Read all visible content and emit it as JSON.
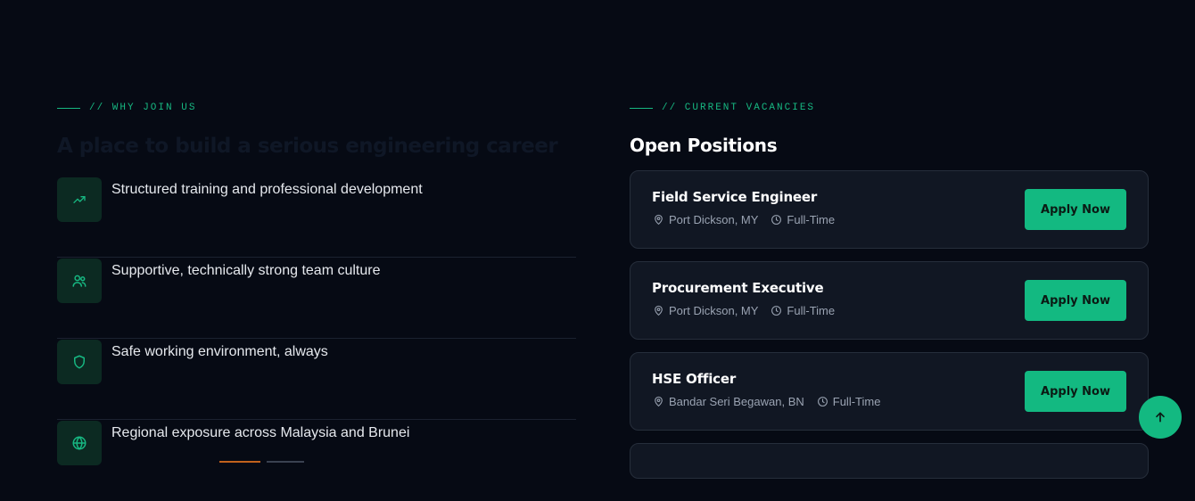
{
  "why_join": {
    "eyebrow": "// WHY JOIN US",
    "heading": "A place to build a serious engineering career",
    "benefits": [
      {
        "icon": "trending-up-icon",
        "text": "Structured training and professional development"
      },
      {
        "icon": "users-icon",
        "text": "Supportive, technically strong team culture"
      },
      {
        "icon": "shield-icon",
        "text": "Safe working environment, always"
      },
      {
        "icon": "globe-icon",
        "text": "Regional exposure across Malaysia and Brunei"
      }
    ]
  },
  "vacancies": {
    "eyebrow": "// CURRENT VACANCIES",
    "title": "Open Positions",
    "apply_label": "Apply Now",
    "jobs": [
      {
        "title": "Field Service Engineer",
        "location": "Port Dickson, MY",
        "type": "Full-Time"
      },
      {
        "title": "Procurement Executive",
        "location": "Port Dickson, MY",
        "type": "Full-Time"
      },
      {
        "title": "HSE Officer",
        "location": "Bandar Seri Begawan, BN",
        "type": "Full-Time"
      }
    ]
  },
  "colors": {
    "background": "#060a14",
    "accent": "#13b981",
    "card": "#111723"
  }
}
